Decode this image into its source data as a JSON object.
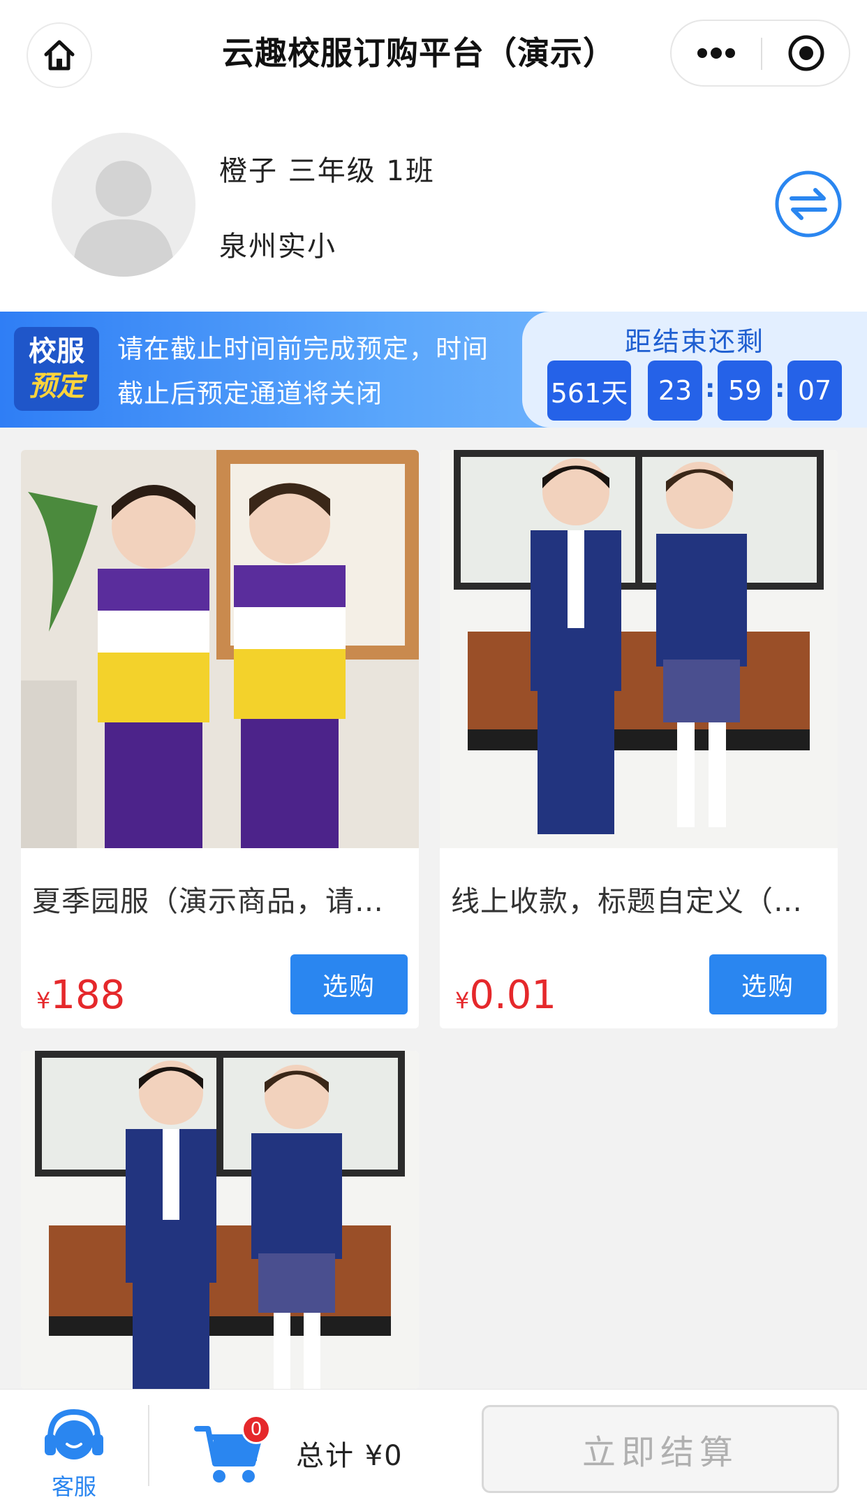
{
  "header": {
    "title": "云趣校服订购平台（演示）",
    "home_icon": "home-icon",
    "more_icon": "more-dots-icon",
    "close_icon": "record-target-icon"
  },
  "profile": {
    "student_line": "橙子  三年级 1班",
    "school": "泉州实小",
    "switch_icon": "swap-arrows-icon"
  },
  "banner": {
    "badge_line1": "校服",
    "badge_line2": "预定",
    "notice": "请在截止时间前完成预定，时间截止后预定通道将关闭",
    "countdown_title": "距结束还剩",
    "days": "561天",
    "hours": "23",
    "minutes": "59",
    "seconds": "07",
    "colon": ":"
  },
  "products": [
    {
      "name": "夏季园服（演示商品，请勿下单）",
      "currency": "¥",
      "price": "188",
      "button": "选购"
    },
    {
      "name": "线上收款，标题自定义（演示）",
      "currency": "¥",
      "price": "0.01",
      "button": "选购"
    },
    {
      "name": "",
      "currency": "",
      "price": "",
      "button": ""
    }
  ],
  "bottom": {
    "service_label": "客服",
    "cart_count": "0",
    "total": "总计 ¥0",
    "checkout": "立即结算"
  },
  "colors": {
    "primary_blue": "#2a86f0",
    "price_red": "#e5282b",
    "countdown_box": "#2562e8",
    "badge_yellow": "#ffd43b"
  }
}
